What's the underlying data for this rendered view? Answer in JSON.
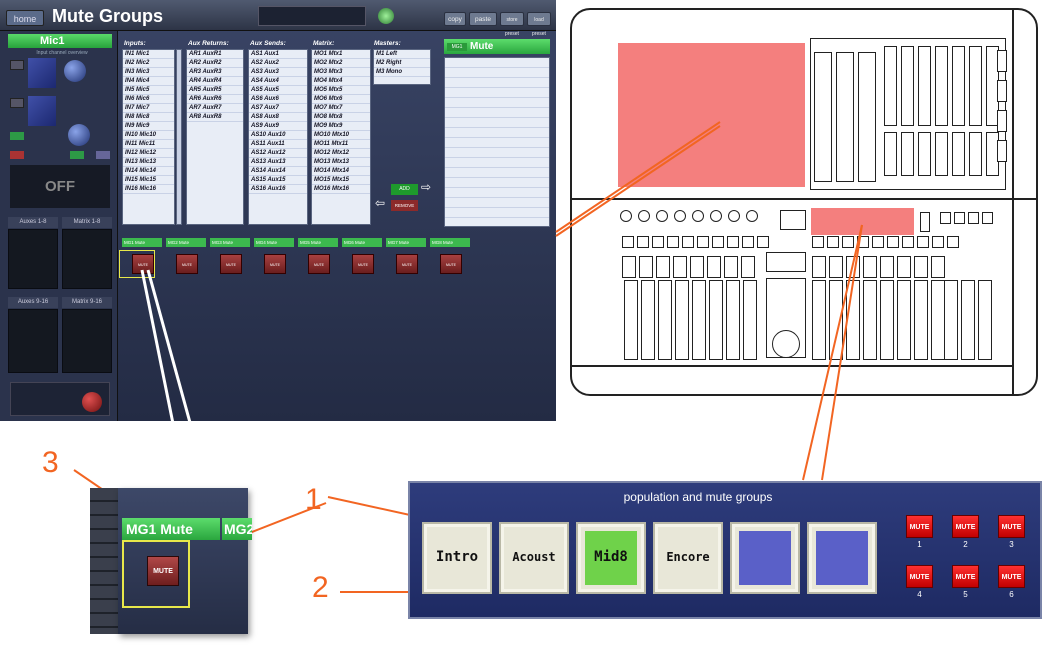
{
  "screen": {
    "home_label": "home",
    "title": "Mute Groups",
    "top_buttons": [
      "copy",
      "paste",
      "store preset",
      "load preset"
    ],
    "channel_name": "Mic1",
    "channel_sub": "Input channel overview",
    "off_label": "OFF",
    "meter_headers": [
      "Auxes 1-8",
      "Matrix 1-8",
      "Auxes 9-16",
      "Matrix 9-16"
    ],
    "columns": [
      {
        "title": "Inputs:",
        "items": [
          "IN1 Mic1",
          "IN2 Mic2",
          "IN3 Mic3",
          "IN4 Mic4",
          "IN5 Mic5",
          "IN6 Mic6",
          "IN7 Mic7",
          "IN8 Mic8",
          "IN9 Mic9",
          "IN10 Mic10",
          "IN11 Mic11",
          "IN12 Mic12",
          "IN13 Mic13",
          "IN14 Mic14",
          "IN15 Mic15",
          "IN16 Mic16"
        ]
      },
      {
        "title": "Aux Returns:",
        "items": [
          "AR1 AuxR1",
          "AR2 AuxR2",
          "AR3 AuxR3",
          "AR4 AuxR4",
          "AR5 AuxR5",
          "AR6 AuxR6",
          "AR7 AuxR7",
          "AR8 AuxR8"
        ]
      },
      {
        "title": "Aux Sends:",
        "items": [
          "AS1 Aux1",
          "AS2 Aux2",
          "AS3 Aux3",
          "AS4 Aux4",
          "AS5 Aux5",
          "AS6 Aux6",
          "AS7 Aux7",
          "AS8 Aux8",
          "AS9 Aux9",
          "AS10 Aux10",
          "AS11 Aux11",
          "AS12 Aux12",
          "AS13 Aux13",
          "AS14 Aux14",
          "AS15 Aux15",
          "AS16 Aux16"
        ]
      },
      {
        "title": "Matrix:",
        "items": [
          "MO1 Mtx1",
          "MO2 Mtx2",
          "MO3 Mtx3",
          "MO4 Mtx4",
          "MO5 Mtx5",
          "MO6 Mtx6",
          "MO7 Mtx7",
          "MO8 Mtx8",
          "MO9 Mtx9",
          "MO10 Mtx10",
          "MO11 Mtx11",
          "MO12 Mtx12",
          "MO13 Mtx13",
          "MO14 Mtx14",
          "MO15 Mtx15",
          "MO16 Mtx16"
        ]
      },
      {
        "title": "Masters:",
        "items": [
          "M1 Left",
          "M2 Right",
          "M3 Mono"
        ]
      }
    ],
    "mute_panel_label": "Mute",
    "mute_panel_tag": "MG1",
    "add_label": "ADD",
    "remove_label": "REMOVE",
    "mute_groups": [
      "MG1 Mute",
      "MG2 Mute",
      "MG3 Mute",
      "MG4 Mute",
      "MG5 Mute",
      "MG6 Mute",
      "MG7 Mute",
      "MG8 Mute"
    ],
    "mute_button_label": "MUTE"
  },
  "zoom": {
    "group_label": "MG1 Mute",
    "next_label": "MG2",
    "mute_label": "MUTE"
  },
  "population_panel": {
    "title": "population and mute groups",
    "buttons": [
      "Intro",
      "Acoust",
      "Mid8",
      "Encore",
      "",
      ""
    ],
    "active_index": 2,
    "mute_buttons": [
      {
        "label": "MUTE",
        "number": "1"
      },
      {
        "label": "MUTE",
        "number": "2"
      },
      {
        "label": "MUTE",
        "number": "3"
      },
      {
        "label": "MUTE",
        "number": "4"
      },
      {
        "label": "MUTE",
        "number": "5"
      },
      {
        "label": "MUTE",
        "number": "6"
      }
    ]
  },
  "callouts": [
    "1",
    "2",
    "3"
  ],
  "colors": {
    "callout": "#f26522",
    "highlight_pink": "#f47f7e",
    "active_green": "#6fd24a",
    "mute_red": "#e00000"
  }
}
